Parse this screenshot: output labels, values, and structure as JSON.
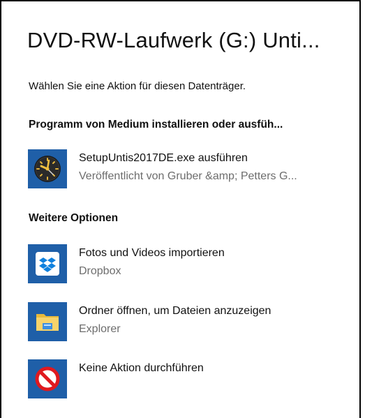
{
  "dialog": {
    "title": "DVD-RW-Laufwerk (G:) Unti...",
    "subtitle": "Wählen Sie eine Aktion für diesen Datenträger."
  },
  "sections": {
    "install": {
      "heading": "Programm von Medium installieren oder ausfüh...",
      "items": [
        {
          "label": "SetupUntis2017DE.exe ausführen",
          "sub": "Veröffentlicht von Gruber &amp; Petters G...",
          "icon": "untis-clock-icon"
        }
      ]
    },
    "more": {
      "heading": "Weitere Optionen",
      "items": [
        {
          "label": "Fotos und Videos importieren",
          "sub": "Dropbox",
          "icon": "dropbox-icon"
        },
        {
          "label": "Ordner öffnen, um Dateien anzuzeigen",
          "sub": "Explorer",
          "icon": "folder-icon"
        },
        {
          "label": "Keine Aktion durchführen",
          "sub": "",
          "icon": "no-action-icon"
        }
      ]
    }
  },
  "colors": {
    "tile_blue": "#1f5fa8",
    "dropbox_blue": "#1081de",
    "folder_yellow": "#f4c74a",
    "prohibit_red": "#e0191f"
  }
}
